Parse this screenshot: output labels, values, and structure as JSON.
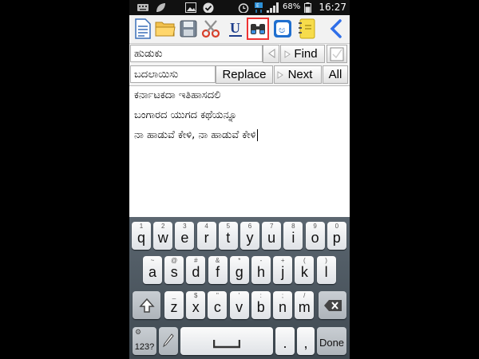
{
  "status_bar": {
    "battery_percent": "68%",
    "time": "16:27"
  },
  "toolbar": {
    "icons": [
      "document-icon",
      "folder-icon",
      "save-icon",
      "scissors-icon",
      "underline-icon",
      "find-icon",
      "kannada-keyboard-icon",
      "notebook-icon",
      "back-icon"
    ],
    "underline_label": "U",
    "kannada_char": "ಅ"
  },
  "find": {
    "value": "ಹುಡುಕು",
    "button": "Find"
  },
  "replace": {
    "value": "ಬದಲಾಯಿಸು",
    "replace_button": "Replace",
    "next_button": "Next",
    "all_button": "All"
  },
  "editor": {
    "lines": [
      "ಕರ್ನಾಟಕದಾ ಇತಿಹಾಸದಲಿ",
      "ಬಂಗಾರದ ಯುಗದ ಕಥೆಯನ್ನೂ",
      "ನಾ ಹಾಡುವೆ ಕೇಳಿ, ನಾ ಹಾಡುವೆ ಕೇಳಿ"
    ]
  },
  "keyboard": {
    "row1": [
      {
        "k": "q",
        "h": "1"
      },
      {
        "k": "w",
        "h": "2"
      },
      {
        "k": "e",
        "h": "3"
      },
      {
        "k": "r",
        "h": "4"
      },
      {
        "k": "t",
        "h": "5"
      },
      {
        "k": "y",
        "h": "6"
      },
      {
        "k": "u",
        "h": "7"
      },
      {
        "k": "i",
        "h": "8"
      },
      {
        "k": "o",
        "h": "9"
      },
      {
        "k": "p",
        "h": "0"
      }
    ],
    "row2": [
      {
        "k": "a",
        "h": "~"
      },
      {
        "k": "s",
        "h": "@"
      },
      {
        "k": "d",
        "h": "#"
      },
      {
        "k": "f",
        "h": "&"
      },
      {
        "k": "g",
        "h": "*"
      },
      {
        "k": "h",
        "h": "-"
      },
      {
        "k": "j",
        "h": "+"
      },
      {
        "k": "k",
        "h": "("
      },
      {
        "k": "l",
        "h": ")"
      }
    ],
    "row3": [
      {
        "k": "z",
        "h": "_"
      },
      {
        "k": "x",
        "h": "$"
      },
      {
        "k": "c",
        "h": "\""
      },
      {
        "k": "v",
        "h": "'"
      },
      {
        "k": "b",
        "h": ":"
      },
      {
        "k": "n",
        "h": ";"
      },
      {
        "k": "m",
        "h": "/"
      }
    ],
    "symbols_label": "123?",
    "period": ".",
    "comma": ",",
    "done_label": "Done"
  }
}
